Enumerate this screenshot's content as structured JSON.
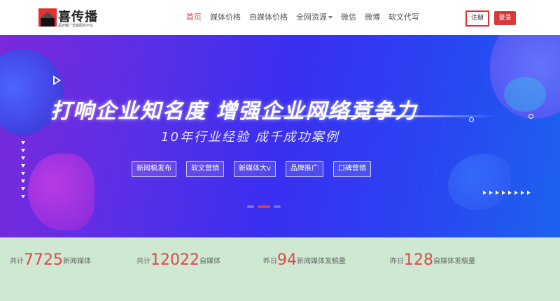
{
  "header": {
    "logo": {
      "title": "喜传播",
      "subtitle": "品牌推广营销服务平台"
    },
    "nav": [
      {
        "label": "首页",
        "active": true
      },
      {
        "label": "媒体价格"
      },
      {
        "label": "自媒体价格"
      },
      {
        "label": "全网资源",
        "dropdown": true
      },
      {
        "label": "微信"
      },
      {
        "label": "微博"
      },
      {
        "label": "软文代写"
      }
    ],
    "register_label": "注册",
    "login_label": "登录"
  },
  "banner": {
    "headline": "打响企业知名度  增强企业网络竞争力",
    "subline": "10年行业经验  成千成功案例",
    "tags": [
      "新闻稿发布",
      "软文营销",
      "新媒体大v",
      "品牌推广",
      "口碑营销"
    ],
    "slide_active_index": 1,
    "slide_count": 3
  },
  "stats": [
    {
      "prefix": "共计",
      "value": "7725",
      "suffix": "新闻媒体"
    },
    {
      "prefix": "共计",
      "value": "12022",
      "suffix": "自媒体"
    },
    {
      "prefix": "昨日",
      "value": "94",
      "suffix": "新闻媒体发稿量"
    },
    {
      "prefix": "昨日",
      "value": "128",
      "suffix": "自媒体发稿量"
    }
  ],
  "colors": {
    "accent": "#e04848",
    "stats_bg": "#cfe8d2"
  }
}
